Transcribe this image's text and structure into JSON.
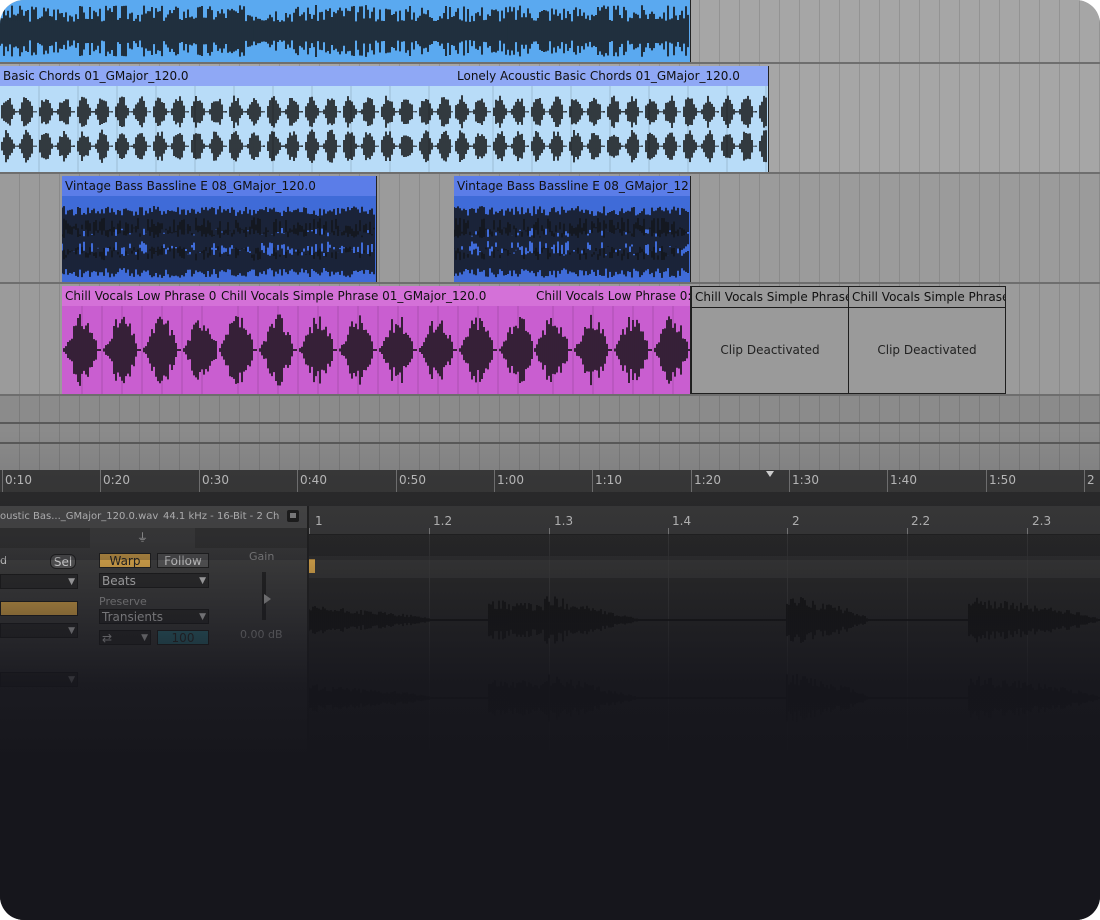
{
  "arrangement": {
    "clips": {
      "top": [
        {
          "name": ""
        }
      ],
      "chords": [
        {
          "name": "Basic Chords 01_GMajor_120.0"
        },
        {
          "name": "Lonely Acoustic Basic Chords 01_GMajor_120.0"
        }
      ],
      "bass": [
        {
          "name": "Vintage Bass Bassline E 08_GMajor_120.0"
        },
        {
          "name": "Vintage Bass Bassline E 08_GMajor_12"
        }
      ],
      "vocals": [
        {
          "name": "Chill Vocals Low Phrase 0"
        },
        {
          "name": "Chill Vocals Simple Phrase 01_GMajor_120.0"
        },
        {
          "name": "Chill Vocals Low Phrase 0:"
        }
      ],
      "deactivated": [
        {
          "name": "Chill Vocals Simple Phrase",
          "message": "Clip Deactivated"
        },
        {
          "name": "Chill Vocals Simple Phrase",
          "message": "Clip Deactivated"
        }
      ]
    },
    "ruler": [
      "0:10",
      "0:20",
      "0:30",
      "0:40",
      "0:50",
      "1:00",
      "1:10",
      "1:20",
      "1:30",
      "1:40",
      "1:50",
      "2"
    ]
  },
  "detail": {
    "file_name": "oustic Bas..._GMajor_120.0.wav",
    "file_format": "44.1 kHz - 16-Bit - 2 Ch",
    "left_col": {
      "label_d": "d",
      "sel_button": "Sel"
    },
    "warp_button": "Warp",
    "follow_button": "Follow",
    "warp_mode": "Beats",
    "preserve_label": "Preserve",
    "preserve_value": "Transients",
    "loop_mode": "⇄",
    "envelope_value": "100",
    "gain_label": "Gain",
    "gain_value": "0.00 dB",
    "sample_ruler": [
      "1",
      "1.2",
      "1.3",
      "1.4",
      "2",
      "2.2",
      "2.3"
    ]
  },
  "colors": {
    "top": "#5aa9f0",
    "chords_header": "#8fa8f5",
    "chords_body": "#b8dcf8",
    "bass_header": "#5b7de8",
    "bass_body": "#3f6bd8",
    "vocals_header": "#d471d8",
    "vocals_body": "#c95ed0",
    "warp_on": "#d9a64a"
  }
}
